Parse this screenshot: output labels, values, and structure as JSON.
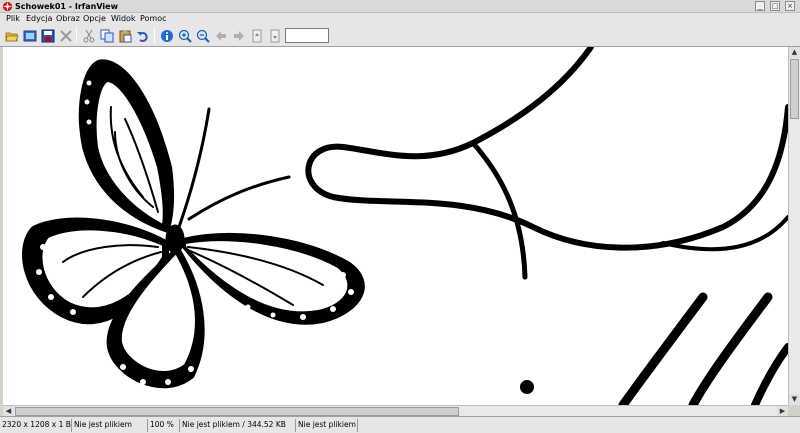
{
  "window": {
    "title": "Schowek01 - IrfanView"
  },
  "titlebar": {
    "minimize": "_",
    "maximize": "□",
    "close": "×"
  },
  "menu": [
    "Plik",
    "Edycja",
    "Obraz",
    "Opcje",
    "Widok",
    "Pomoc"
  ],
  "toolbar": {
    "buttons": [
      "open-icon",
      "slideshow-icon",
      "save-icon",
      "delete-icon",
      "cut-icon",
      "copy-icon",
      "paste-icon",
      "undo-icon",
      "info-icon",
      "zoom-in-icon",
      "zoom-out-icon",
      "previous-icon",
      "next-icon",
      "page-up-icon",
      "page-down-icon"
    ],
    "page_input": ""
  },
  "status": {
    "dimensions": "2320 x 1208 x 1 BPP",
    "file": "Nie jest plikiem",
    "zoom": "100 %",
    "size": "Nie jest plikiem / 344.52 KB",
    "extra": "Nie jest plikiem"
  },
  "colors": {
    "titlebar": "#d9d9d9",
    "toolbar": "#e6e6e6",
    "canvas": "#ffffff",
    "ink": "#000000"
  }
}
